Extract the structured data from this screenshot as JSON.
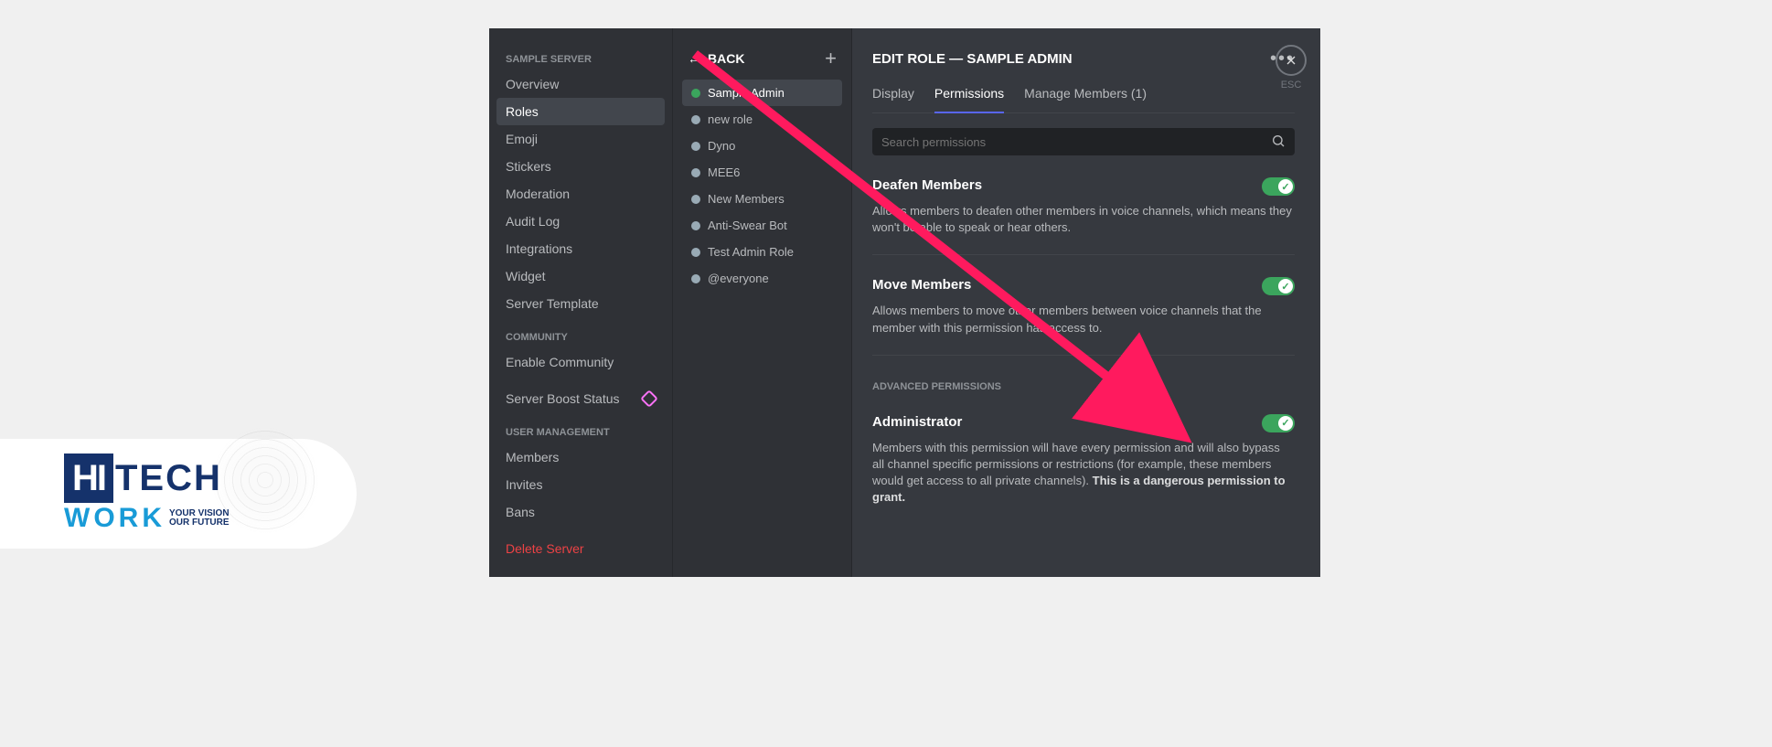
{
  "logo": {
    "line1_h": "HI",
    "line1_rest": "TECH",
    "line2": "WORK",
    "tag1": "YOUR VISION",
    "tag2": "OUR FUTURE"
  },
  "settings_nav": {
    "server_header": "SAMPLE SERVER",
    "items_server": [
      "Overview",
      "Roles",
      "Emoji",
      "Stickers",
      "Moderation",
      "Audit Log",
      "Integrations",
      "Widget",
      "Server Template"
    ],
    "community_header": "COMMUNITY",
    "items_community": [
      "Enable Community"
    ],
    "boost_label": "Server Boost Status",
    "user_mgmt_header": "USER MANAGEMENT",
    "items_user": [
      "Members",
      "Invites",
      "Bans"
    ],
    "delete_label": "Delete Server"
  },
  "roles_col": {
    "back_label": "BACK",
    "roles": [
      {
        "name": "Sample Admin",
        "color": "#3ba55d",
        "active": true
      },
      {
        "name": "new role",
        "color": "#99aab5"
      },
      {
        "name": "Dyno",
        "color": "#99aab5"
      },
      {
        "name": "MEE6",
        "color": "#99aab5"
      },
      {
        "name": "New Members",
        "color": "#99aab5"
      },
      {
        "name": "Anti-Swear Bot",
        "color": "#99aab5"
      },
      {
        "name": "Test Admin Role",
        "color": "#99aab5"
      },
      {
        "name": "@everyone",
        "color": "#99aab5"
      }
    ]
  },
  "main": {
    "title": "EDIT ROLE — SAMPLE ADMIN",
    "tabs": {
      "display": "Display",
      "permissions": "Permissions",
      "manage": "Manage Members (1)"
    },
    "search_placeholder": "Search permissions",
    "perm1_title": "Deafen Members",
    "perm1_desc": "Allows members to deafen other members in voice channels, which means they won't be able to speak or hear others.",
    "perm2_title": "Move Members",
    "perm2_desc": "Allows members to move other members between voice channels that the member with this permission has access to.",
    "adv_header": "ADVANCED PERMISSIONS",
    "perm3_title": "Administrator",
    "perm3_desc_a": "Members with this permission will have every permission and will also bypass all channel specific permissions or restrictions (for example, these members would get access to all private channels). ",
    "perm3_desc_b": "This is a dangerous permission to grant.",
    "esc_label": "ESC"
  }
}
